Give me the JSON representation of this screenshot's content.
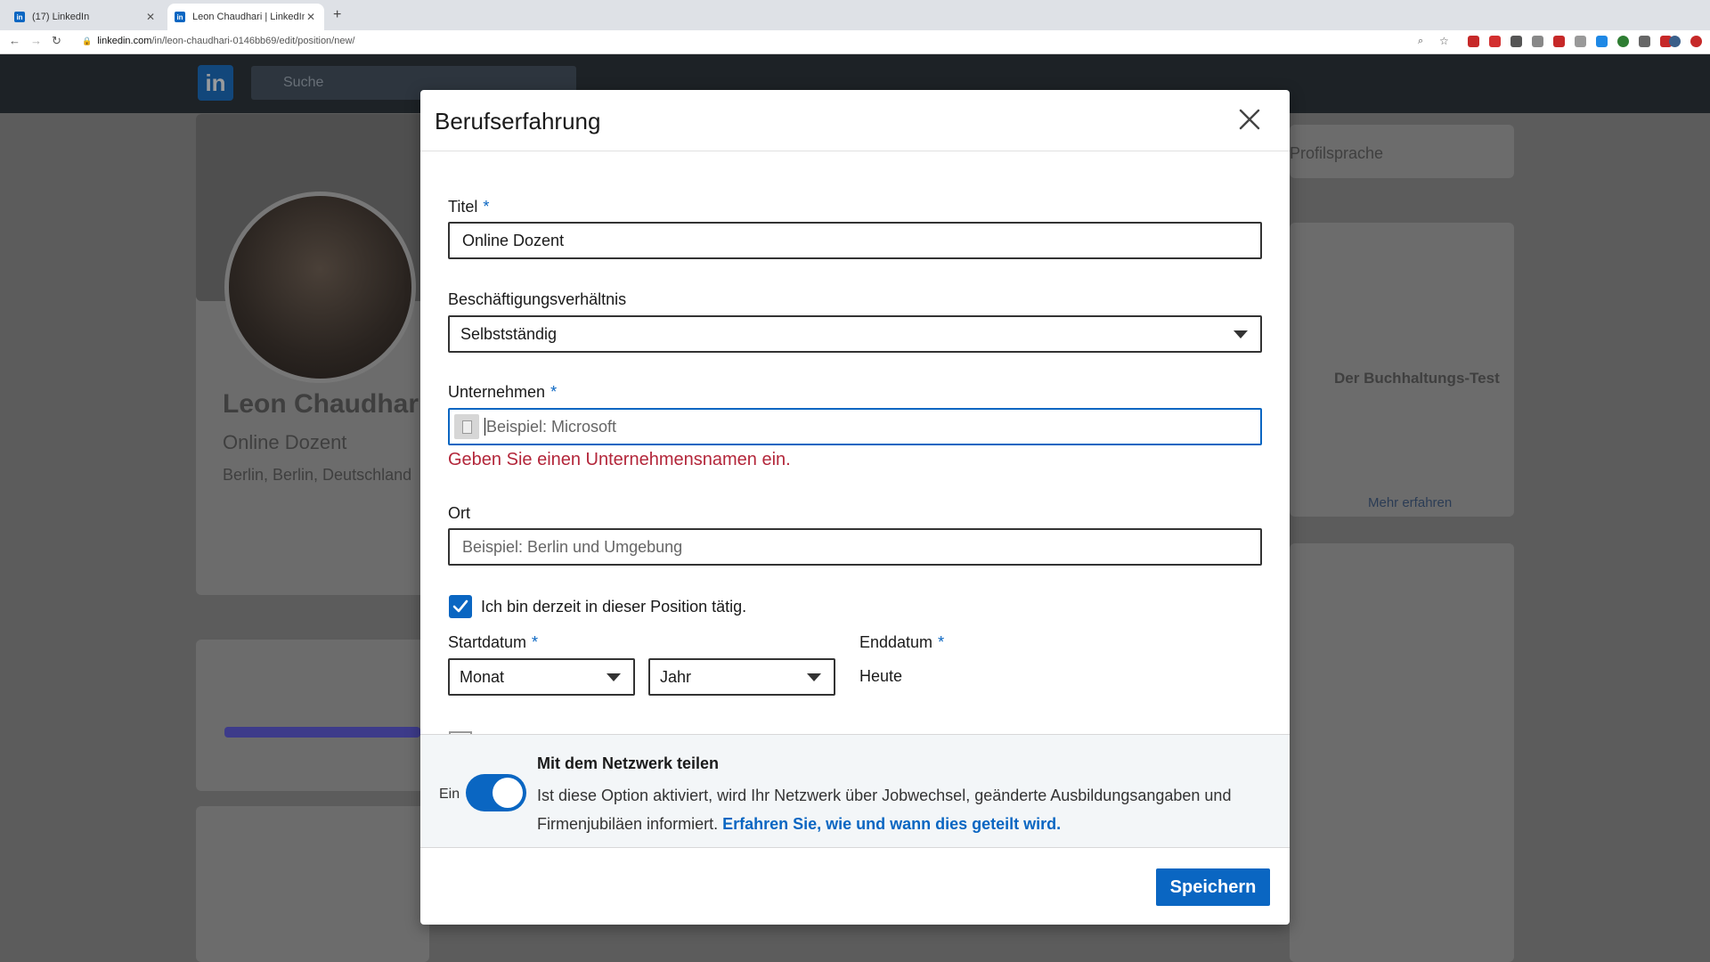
{
  "browser": {
    "tabs": [
      {
        "title": "(17) LinkedIn",
        "active": false
      },
      {
        "title": "Leon Chaudhari | LinkedIn",
        "active": true
      }
    ],
    "url_host": "linkedin.com",
    "url_path": "/in/leon-chaudhari-0146bb69/edit/position/new/"
  },
  "background": {
    "logo": "in",
    "search_placeholder": "Suche",
    "profile_name": "Leon Chaudhari",
    "profile_headline": "Online Dozent",
    "profile_location": "Berlin, Berlin, Deutschland",
    "side_text": "Profilsprache",
    "side_card_title": "Der Buchhaltungs-Test",
    "side_card_link": "Mehr erfahren"
  },
  "modal": {
    "title": "Berufserfahrung",
    "title_field": {
      "label": "Titel",
      "required": "*",
      "value": "Online Dozent"
    },
    "employment_field": {
      "label": "Beschäftigungsverhältnis",
      "value": "Selbstständig"
    },
    "company_field": {
      "label": "Unternehmen",
      "required": "*",
      "placeholder": "Beispiel: Microsoft",
      "error": "Geben Sie einen Unternehmensnamen ein."
    },
    "location_field": {
      "label": "Ort",
      "placeholder": "Beispiel: Berlin und Umgebung"
    },
    "current_position": {
      "label": "Ich bin derzeit in dieser Position tätig.",
      "checked": true
    },
    "start_date": {
      "label": "Startdatum",
      "required": "*",
      "month": "Monat",
      "year": "Jahr"
    },
    "end_date": {
      "label": "Enddatum",
      "required": "*",
      "value": "Heute"
    },
    "share": {
      "title": "Mit dem Netzwerk teilen",
      "toggle_label": "Ein",
      "desc": "Ist diese Option aktiviert, wird Ihr Netzwerk über Jobwechsel, geänderte Ausbildungsangaben und Firmenjubiläen informiert.",
      "link": "Erfahren Sie, wie und wann dies geteilt wird."
    },
    "save_label": "Speichern"
  },
  "colors": {
    "accent": "#0a66c2",
    "error": "#b3263a"
  }
}
